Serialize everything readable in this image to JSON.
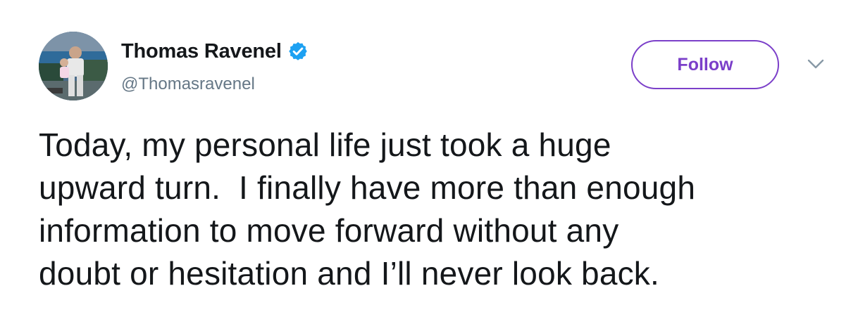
{
  "author": {
    "display_name": "Thomas Ravenel",
    "handle": "@Thomasravenel",
    "verified": true,
    "verified_color": "#1da1f2"
  },
  "actions": {
    "follow_label": "Follow",
    "follow_color": "#7b3fc9",
    "menu_icon": "chevron-down-icon"
  },
  "tweet": {
    "lines": [
      "Today, my personal life just took a huge",
      "upward turn.  I finally have more than enough",
      "information to move forward without any",
      "doubt or hesitation and I’ll never look back."
    ]
  }
}
